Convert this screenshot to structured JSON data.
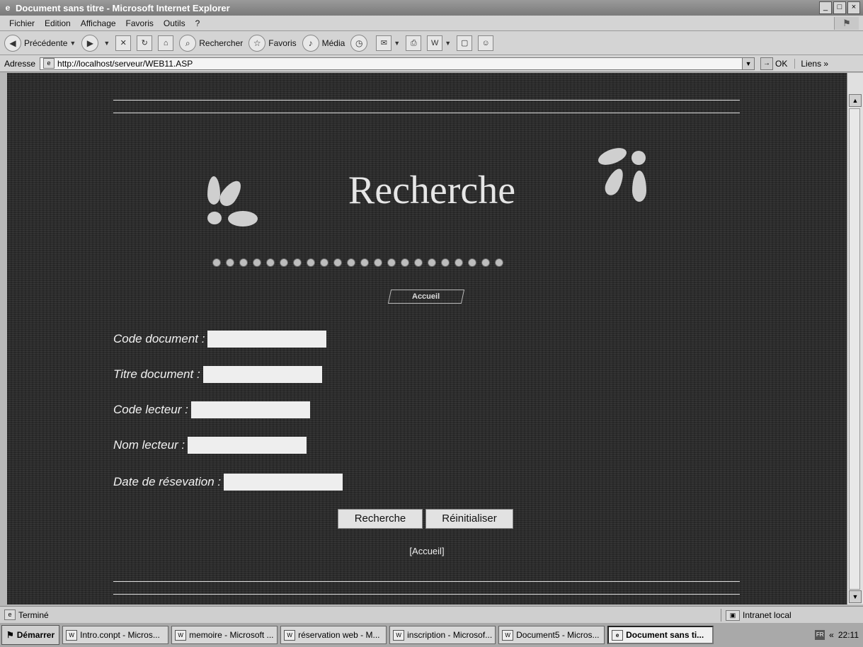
{
  "window": {
    "title": "Document sans titre - Microsoft Internet Explorer",
    "controls": [
      "_",
      "□",
      "×"
    ]
  },
  "menubar": {
    "items": [
      "Fichier",
      "Edition",
      "Affichage",
      "Favoris",
      "Outils",
      "?"
    ]
  },
  "toolbar": {
    "back_label": "Précédente",
    "search_label": "Rechercher",
    "favorites_label": "Favoris",
    "media_label": "Média"
  },
  "address": {
    "label": "Adresse",
    "url": "http://localhost/serveur/WEB11.ASP",
    "go_label": "OK",
    "links_label": "Liens"
  },
  "page": {
    "title": "Recherche",
    "home_button": "Accueil",
    "fields": [
      {
        "label": "Code document :",
        "value": ""
      },
      {
        "label": "Titre document :",
        "value": ""
      },
      {
        "label": "Code lecteur :",
        "value": ""
      },
      {
        "label": "Nom lecteur :",
        "value": ""
      },
      {
        "label": "Date de résevation :",
        "value": ""
      }
    ],
    "search_button": "Recherche",
    "reset_button": "Réinitialiser",
    "footer_link": "[Accueil]",
    "colors": {
      "background": "#2c2c2c",
      "text": "#f2f2f2",
      "input": "#eeeeee"
    }
  },
  "statusbar": {
    "status": "Terminé",
    "zone": "Intranet local"
  },
  "taskbar": {
    "start": "Démarrer",
    "tasks": [
      "Intro.conpt - Micros...",
      "memoire - Microsoft ...",
      "réservation web - M...",
      "inscription - Microsof...",
      "Document5 - Micros...",
      "Document sans ti..."
    ],
    "lang": "FR",
    "clock": "22:11"
  }
}
